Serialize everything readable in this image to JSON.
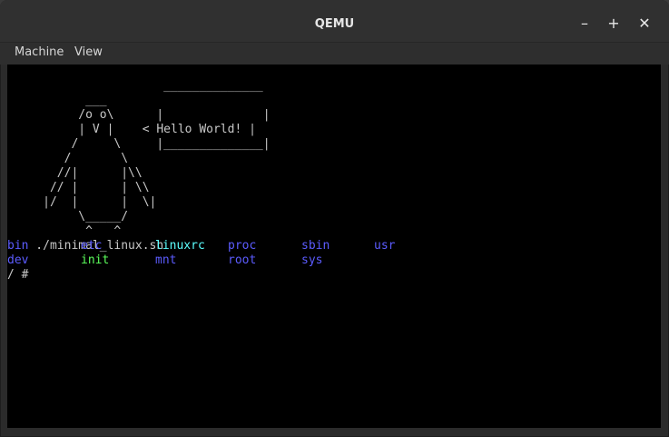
{
  "window": {
    "title": "QEMU",
    "controls": {
      "minimize": "–",
      "maximize": "+",
      "close": "✕"
    }
  },
  "menu": {
    "items": [
      "Machine",
      "View"
    ]
  },
  "terminal": {
    "art_lines": [
      "           ___",
      "          /o o\\      |              |",
      "          | V |    < Hello World! |",
      "         /     \\     |______________|",
      "        /       \\",
      "       //|      |\\\\",
      "      // |      | \\\\",
      "     |/  |      |  \\|",
      "          \\_____/",
      "           ^   ^",
      "    ./minimal_linux.sh"
    ],
    "art_top": "                      ______________",
    "ls_row1": [
      "bin",
      "etc",
      "linuxrc",
      "proc",
      "sbin",
      "usr"
    ],
    "ls_row2": [
      "dev",
      "init",
      "mnt",
      "root",
      "sys"
    ],
    "prompt": "/ #",
    "colors": {
      "dir": "#5c5cff",
      "link": "#5cffff",
      "exec": "#5cff5c",
      "text": "#c8c8c8"
    }
  }
}
